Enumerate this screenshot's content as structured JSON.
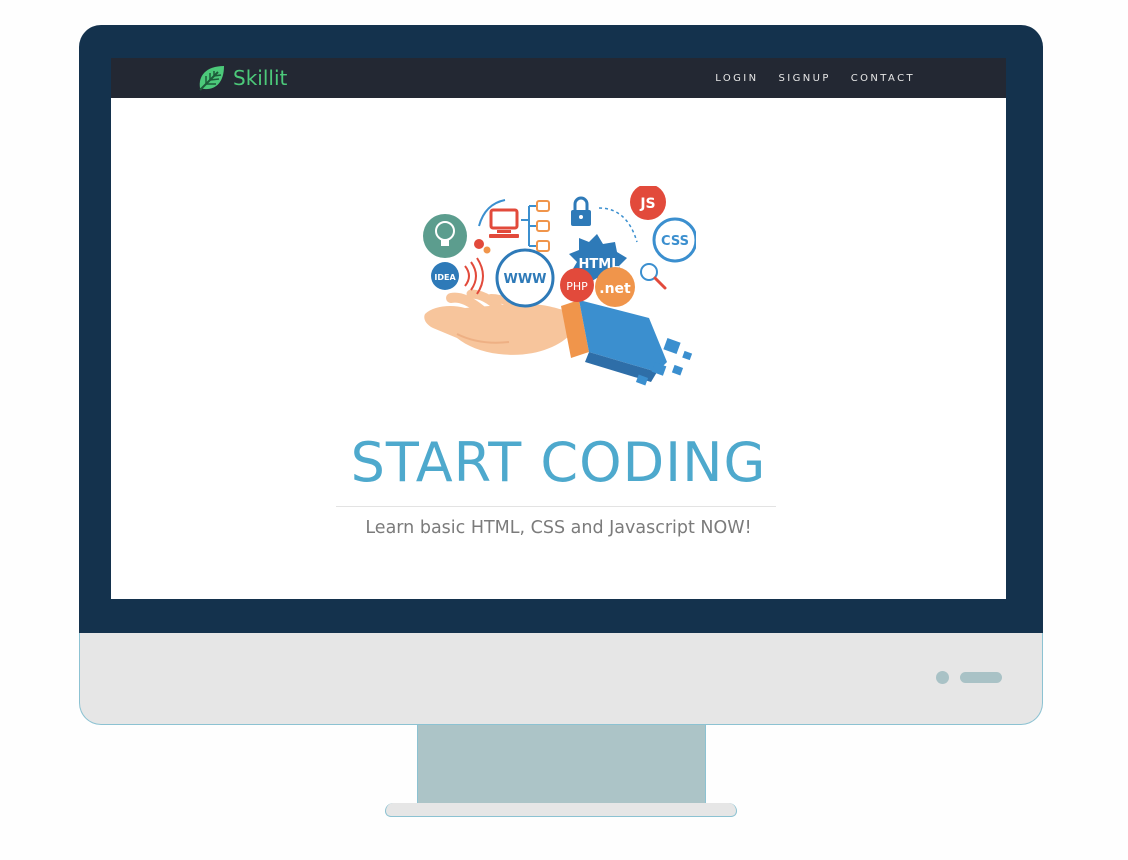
{
  "navbar": {
    "brand": "Skillit",
    "links": [
      {
        "label": "LOGIN"
      },
      {
        "label": "SIGNUP"
      },
      {
        "label": "CONTACT"
      }
    ]
  },
  "hero": {
    "title": "START CODING",
    "subtitle": "Learn basic HTML, CSS and Javascript NOW!",
    "illustration": {
      "badges": {
        "js": "JS",
        "css": "CSS",
        "html": "HTML",
        "www": "WWW",
        "php": "PHP",
        "net": ".net",
        "idea": "IDEA"
      },
      "icons": [
        "lightbulb-icon",
        "gear-icon",
        "computer-icon",
        "sitemap-icon",
        "lock-icon",
        "magnifier-icon",
        "wifi-icon",
        "refresh-icon"
      ]
    }
  },
  "colors": {
    "bezel": "#14324d",
    "navbar": "#232833",
    "brand": "#4cc97a",
    "title": "#4ea9cd",
    "subtitle": "#7b7b7b",
    "chin": "#e6e6e6",
    "stand": "#acc4c7"
  }
}
